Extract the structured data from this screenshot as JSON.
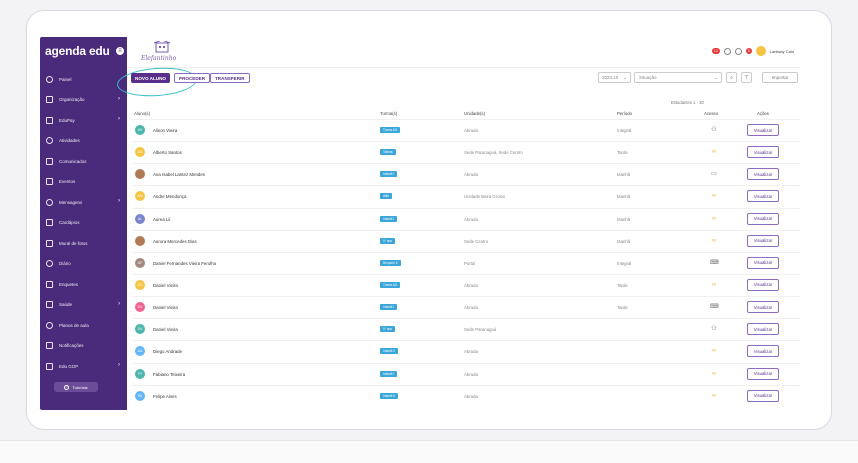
{
  "app": {
    "logo": "agenda edu",
    "school_name": "Elefantinho"
  },
  "topbar": {
    "badge_1": "12",
    "badge_2": "8",
    "user_name": "Lantway Cald"
  },
  "sidebar": {
    "items": [
      {
        "label": "Painel",
        "icon": "dashboard-icon",
        "chevron": false
      },
      {
        "label": "Organização",
        "icon": "organization-icon",
        "chevron": true
      },
      {
        "label": "EduPay",
        "icon": "pay-icon",
        "chevron": true
      },
      {
        "label": "Atividades",
        "icon": "activity-icon",
        "chevron": false
      },
      {
        "label": "Comunicados",
        "icon": "announcement-icon",
        "chevron": false
      },
      {
        "label": "Eventos",
        "icon": "calendar-icon",
        "chevron": false
      },
      {
        "label": "Mensagens",
        "icon": "message-icon",
        "chevron": true
      },
      {
        "label": "Cardápios",
        "icon": "menu-icon",
        "chevron": false
      },
      {
        "label": "Mural de fotos",
        "icon": "photo-icon",
        "chevron": false
      },
      {
        "label": "Diário",
        "icon": "diary-icon",
        "chevron": false
      },
      {
        "label": "Enquetes",
        "icon": "poll-icon",
        "chevron": false
      },
      {
        "label": "Saúde",
        "icon": "health-icon",
        "chevron": true
      },
      {
        "label": "Planos de aula",
        "icon": "lesson-icon",
        "chevron": false
      },
      {
        "label": "Notificações",
        "icon": "notification-icon",
        "chevron": false
      },
      {
        "label": "Edu GOP",
        "icon": "rocket-icon",
        "chevron": true
      }
    ],
    "tutorial_label": "Tutoriais"
  },
  "actions": {
    "new_student": "NOVO ALUNO",
    "proceed": "PROCEDER",
    "transfer": "TRANSFERIR",
    "year": "2023.10",
    "situation_placeholder": "Situação",
    "import_label": "Importar",
    "count_label": "Estudantes 1 - 30"
  },
  "table": {
    "headers": {
      "student": "Aluno(s)",
      "class": "Turma(s)",
      "unit": "Unidade(s)",
      "period": "Período",
      "access": "Acesso",
      "actions": "Ações"
    },
    "view_label": "Visualizar",
    "rows": [
      {
        "initials": "AV",
        "color": "#4db6ac",
        "name": "Alison Vieira",
        "class": "Turma AG",
        "unit": "Abrada",
        "period": "Integral",
        "access": "group-icon",
        "access_color": "#666"
      },
      {
        "initials": "AS",
        "color": "#f6c443",
        "name": "Alberto Santos",
        "class": "Tarima",
        "unit": "Sede Paranaguá, Sede Centro",
        "period": "Tarde",
        "access": "link-icon",
        "access_color": "#f5b041"
      },
      {
        "initials": "",
        "color": "#b07a54",
        "name": "Ana Isabel Lantez Mendes",
        "class": "Infantil I",
        "unit": "Abrada",
        "period": "Manhã",
        "access": "monitor-icon",
        "access_color": "#555"
      },
      {
        "initials": "AM",
        "color": "#f6c443",
        "name": "Andre Mendonça",
        "class": "Alibi",
        "unit": "Unidade Beira Grossi",
        "period": "Manhã",
        "access": "link-icon",
        "access_color": "#f5b041"
      },
      {
        "initials": "AL",
        "color": "#7986cb",
        "name": "Aurea Lil",
        "class": "Infantil I",
        "unit": "Abrada",
        "period": "Manhã",
        "access": "link-icon",
        "access_color": "#f5b041"
      },
      {
        "initials": "",
        "color": "#b07a54",
        "name": "Aurora Mercedes Dias",
        "class": "1º ano",
        "unit": "Sede Centro",
        "period": "Manhã",
        "access": "link-icon",
        "access_color": "#f5b041"
      },
      {
        "initials": "DF",
        "color": "#a1887f",
        "name": "Daniel Fernandes Vieira Ferolho",
        "class": "Berçário II",
        "unit": "Portal",
        "period": "Integral",
        "access": "laptop-icon",
        "access_color": "#666"
      },
      {
        "initials": "DV",
        "color": "#f6c443",
        "name": "Daniel Vieira",
        "class": "Turma AG",
        "unit": "Abrada",
        "period": "Tarde",
        "access": "link-icon",
        "access_color": "#f5b041"
      },
      {
        "initials": "DV",
        "color": "#f06292",
        "name": "Daniel Vieira",
        "class": "Infantil I",
        "unit": "Abrada",
        "period": "Tarde",
        "access": "laptop-icon",
        "access_color": "#666"
      },
      {
        "initials": "DV",
        "color": "#4db6ac",
        "name": "Daniel Vieira",
        "class": "1º ano",
        "unit": "Sede Paranaguá",
        "period": "",
        "access": "group-icon",
        "access_color": "#666"
      },
      {
        "initials": "DA",
        "color": "#64b5f6",
        "name": "Diego Andrade",
        "class": "Infantil II",
        "unit": "Abrada",
        "period": "",
        "access": "link-icon",
        "access_color": "#f5b041"
      },
      {
        "initials": "FT",
        "color": "#4db6ac",
        "name": "Fabiano Teixeira",
        "class": "Infantil I",
        "unit": "Abrada",
        "period": "",
        "access": "link-icon",
        "access_color": "#f5b041"
      },
      {
        "initials": "FA",
        "color": "#64b5f6",
        "name": "Felipe Alves",
        "class": "Infantil II",
        "unit": "Abrada",
        "period": "",
        "access": "link-icon",
        "access_color": "#f5b041"
      }
    ]
  }
}
